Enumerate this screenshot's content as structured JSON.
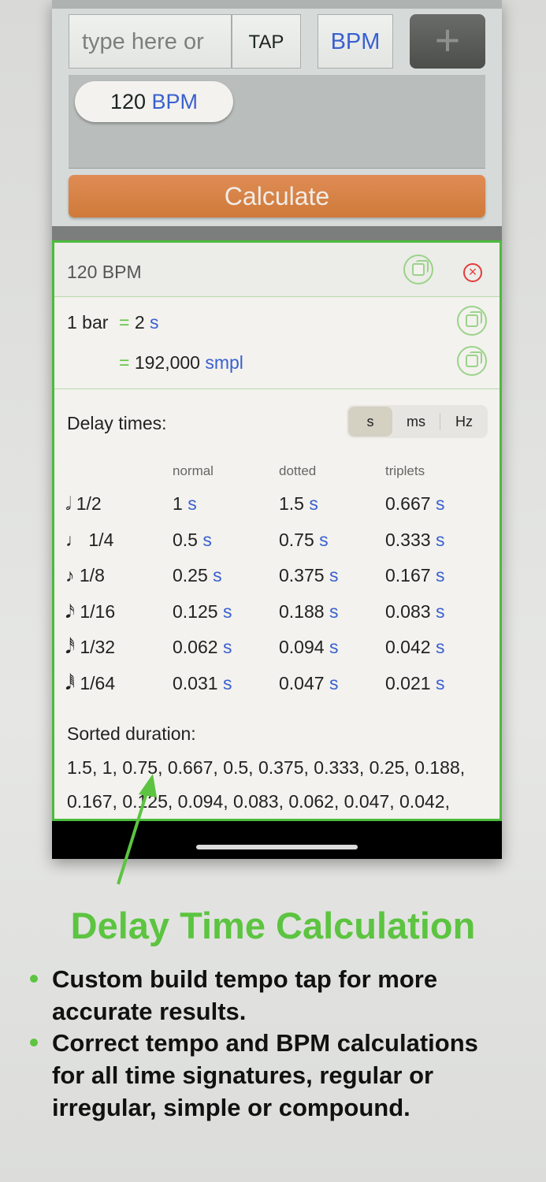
{
  "input": {
    "placeholder": "type here or",
    "tap_label": "TAP",
    "unit_label": "BPM",
    "add_label": "+"
  },
  "tag": {
    "value": "120",
    "unit": "BPM"
  },
  "calculate_label": "Calculate",
  "result": {
    "title": "120 BPM",
    "bar_label": "1 bar",
    "bar_seconds": "= 2",
    "bar_seconds_unit": "s",
    "bar_samples": "= 192,000",
    "bar_samples_unit": "smpl",
    "delay_label": "Delay times:",
    "segments": [
      {
        "label": "s",
        "selected": true
      },
      {
        "label": "ms",
        "selected": false
      },
      {
        "label": "Hz",
        "selected": false
      }
    ],
    "columns": [
      "normal",
      "dotted",
      "triplets"
    ],
    "unit": "s",
    "rows": [
      {
        "icon": "𝅗𝅥",
        "note": "1/2",
        "values": [
          "1",
          "1.5",
          "0.667"
        ]
      },
      {
        "icon": "♩",
        "note": "1/4",
        "values": [
          "0.5",
          "0.75",
          "0.333"
        ]
      },
      {
        "icon": "♪",
        "note": "1/8",
        "values": [
          "0.25",
          "0.375",
          "0.167"
        ]
      },
      {
        "icon": "𝅘𝅥𝅯",
        "note": "1/16",
        "values": [
          "0.125",
          "0.188",
          "0.083"
        ]
      },
      {
        "icon": "𝅘𝅥𝅰",
        "note": "1/32",
        "values": [
          "0.062",
          "0.094",
          "0.042"
        ]
      },
      {
        "icon": "𝅘𝅥𝅱",
        "note": "1/64",
        "values": [
          "0.031",
          "0.047",
          "0.021"
        ]
      }
    ],
    "sorted_label": "Sorted duration:",
    "sorted_line1": "1.5, 1, 0.75, 0.667, 0.5, 0.375, 0.333, 0.25, 0.188,",
    "sorted_line2": "0.167, 0.125, 0.094, 0.083, 0.062, 0.047, 0.042,"
  },
  "promo": {
    "title": "Delay Time Calculation",
    "bullets": [
      [
        "Custom build tempo tap for more",
        "accurate results."
      ],
      [
        "Correct tempo and BPM calculations",
        "for all time signatures, regular or",
        "irregular, simple or compound."
      ]
    ]
  },
  "colors": {
    "accent": "#3a60d0",
    "green": "#5cc440",
    "orange": "#d8844a"
  }
}
